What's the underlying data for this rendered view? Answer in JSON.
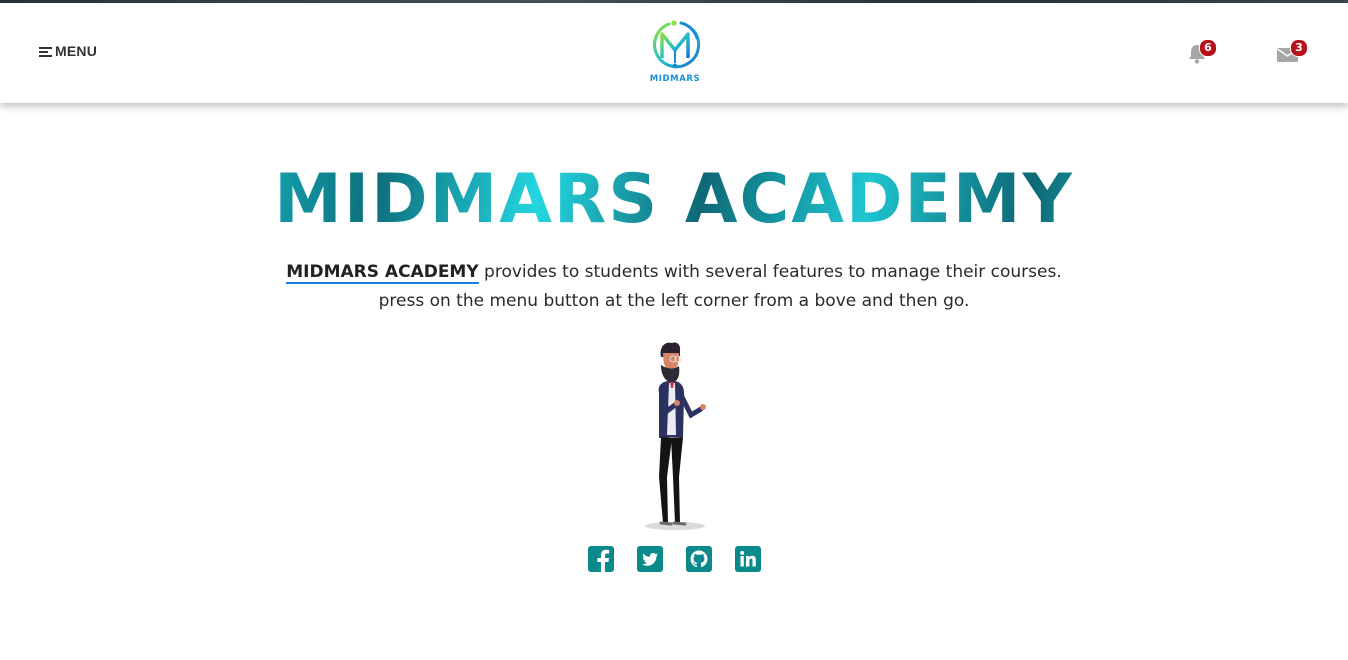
{
  "header": {
    "menu_label": "MENU",
    "logo_text": "MIDMARS",
    "notifications_count": "6",
    "messages_count": "3"
  },
  "hero": {
    "title": "MIDMARS ACADEMY",
    "link_text": "MIDMARS ACADEMY",
    "line1_rest": " provides to students with several features to manage their courses.",
    "line2": "press on the menu button at the left corner from a bove and then go."
  },
  "social": [
    {
      "icon": "facebook-icon"
    },
    {
      "icon": "twitter-icon"
    },
    {
      "icon": "github-icon"
    },
    {
      "icon": "linkedin-icon"
    }
  ],
  "colors": {
    "accent_teal": "#0a8a8a",
    "badge_red": "#b5121b",
    "link_underline": "#1d7fe0",
    "logo_blue": "#1a8fd6"
  }
}
